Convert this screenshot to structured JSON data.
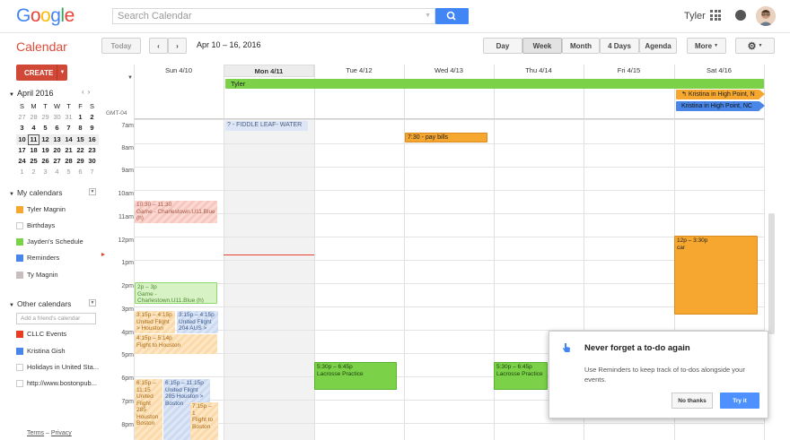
{
  "app": {
    "logo": "Google",
    "title": "Calendar"
  },
  "search": {
    "placeholder": "Search Calendar"
  },
  "header": {
    "user": "Tyler"
  },
  "toolbar": {
    "today": "Today",
    "date_range": "Apr 10 – 16, 2016",
    "views": [
      "Day",
      "Week",
      "Month",
      "4 Days",
      "Agenda"
    ],
    "selected_view": "Week",
    "more": "More"
  },
  "sidebar": {
    "create": "CREATE",
    "mini_title": "April 2016",
    "mini_days": [
      "S",
      "M",
      "T",
      "W",
      "T",
      "F",
      "S"
    ],
    "mini_weeks": [
      [
        "27",
        "28",
        "29",
        "30",
        "31",
        "1",
        "2"
      ],
      [
        "3",
        "4",
        "5",
        "6",
        "7",
        "8",
        "9"
      ],
      [
        "10",
        "11",
        "12",
        "13",
        "14",
        "15",
        "16"
      ],
      [
        "17",
        "18",
        "19",
        "20",
        "21",
        "22",
        "23"
      ],
      [
        "24",
        "25",
        "26",
        "27",
        "28",
        "29",
        "30"
      ],
      [
        "1",
        "2",
        "3",
        "4",
        "5",
        "6",
        "7"
      ]
    ],
    "my_calendars_label": "My calendars",
    "my_calendars": [
      {
        "name": "Tyler Magnin",
        "color": "#f6a72f"
      },
      {
        "name": "Birthdays",
        "color": "#ffffff"
      },
      {
        "name": "Jayden's Schedule",
        "color": "#7bd148"
      },
      {
        "name": "Reminders",
        "color": "#4986e7"
      },
      {
        "name": "Ty Magnin",
        "color": "#cabdbf"
      }
    ],
    "other_calendars_label": "Other calendars",
    "friend_placeholder": "Add a friend's calendar",
    "other_calendars": [
      {
        "name": "CLLC Events",
        "color": "#e53d22"
      },
      {
        "name": "Kristina Gish",
        "color": "#4986e7"
      },
      {
        "name": "Holidays in United Sta...",
        "color": "#ffffff"
      },
      {
        "name": "http://www.bostonpub...",
        "color": "#ffffff"
      }
    ],
    "terms": "Terms",
    "privacy": "Privacy",
    "terms_sep": " – "
  },
  "grid": {
    "days": [
      "Sun 4/10",
      "Mon 4/11",
      "Tue 4/12",
      "Wed 4/13",
      "Thu 4/14",
      "Fri 4/15",
      "Sat 4/16"
    ],
    "timezone": "GMT-04",
    "hours": [
      "7am",
      "8am",
      "9am",
      "10am",
      "11am",
      "12pm",
      "1pm",
      "2pm",
      "3pm",
      "4pm",
      "5pm",
      "6pm",
      "7pm",
      "8pm"
    ]
  },
  "allday_events": [
    {
      "title": "Tyler",
      "color": "#7bd148"
    },
    {
      "title": "Kristina in High Point, N",
      "color": "#f6a72f"
    },
    {
      "title": "Kristina in High Point, NC",
      "color": "#4986e7"
    }
  ],
  "events": {
    "fiddle": "? - FIDDLE LEAF- WATER",
    "bills": "7:30 - pay bills",
    "game1_time": "10:30 – 11:30",
    "game1_title": "Game - Charlestown.U11.Blue (h)",
    "game2_time": "2p – 3p",
    "game2_title": "Game - Charlestown.U11.Blue (h)",
    "flight1_time": "3:15p – 4:15p",
    "flight1_title": "United Flight > Houston",
    "flight2_time": "3:15p – 4:15p",
    "flight2_title": "United Flight 204 AUS >",
    "flight3_time": "4:15p – 5:14p",
    "flight3_title": "Flight to Houston",
    "car_time": "12p – 3:30p",
    "car_title": "car",
    "lax1_time": "5:30p – 6:45p",
    "lax1_title": "Lacrosse Practice",
    "lax2_time": "5:30p – 6:45p",
    "lax2_title": "Lacrosse Practice",
    "flight4_time": "6:15p – 11:15",
    "flight4_title": "United Flight 285 Houston Boston",
    "flight5_time": "6:15p – 11:15p",
    "flight5_title": "United Flight 285 Houston > Boston",
    "flight6_time": "7:15p – 1",
    "flight6_title": "Flight to Boston"
  },
  "popup": {
    "title": "Never forget a to-do again",
    "desc": "Use Reminders to keep track of to-dos alongside your events.",
    "no_thanks": "No thanks",
    "try_it": "Try it"
  }
}
